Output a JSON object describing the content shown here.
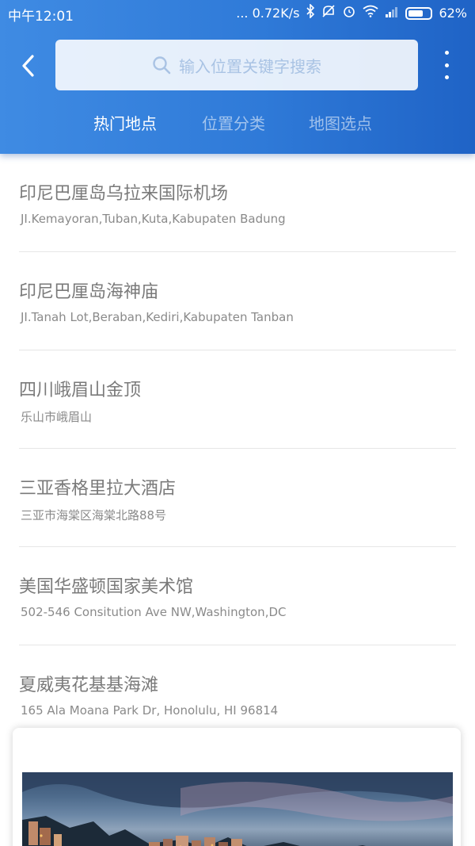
{
  "status_bar": {
    "time": "中午12:01",
    "speed": "... 0.72K/s",
    "battery": "62%"
  },
  "search": {
    "placeholder": "输入位置关键字搜索"
  },
  "tabs": [
    {
      "label": "热门地点",
      "active": true
    },
    {
      "label": "位置分类",
      "active": false
    },
    {
      "label": "地图选点",
      "active": false
    }
  ],
  "places": [
    {
      "title": "印尼巴厘岛乌拉来国际机场",
      "address": "JI.Kemayoran,Tuban,Kuta,Kabupaten Badung"
    },
    {
      "title": "印尼巴厘岛海神庙",
      "address": "JI.Tanah Lot,Beraban,Kediri,Kabupaten Tanban"
    },
    {
      "title": "四川峨眉山金顶",
      "address": "乐山市峨眉山"
    },
    {
      "title": "三亚香格里拉大酒店",
      "address": "三亚市海棠区海棠北路88号"
    },
    {
      "title": "美国华盛顿国家美术馆",
      "address": "502-546 Consitution Ave NW,Washington,DC"
    },
    {
      "title": "夏威夷花基基海滩",
      "address": "165 Ala Moana Park Dr, Honolulu, HI 96814"
    }
  ],
  "colors": {
    "header_start": "#3f8be3",
    "header_end": "#1f63c6",
    "title_text": "#7a7a7a",
    "address_text": "#8a8a8a"
  },
  "icons": {
    "back": "back-arrow-icon",
    "search": "search-icon",
    "more": "more-vertical-icon"
  }
}
